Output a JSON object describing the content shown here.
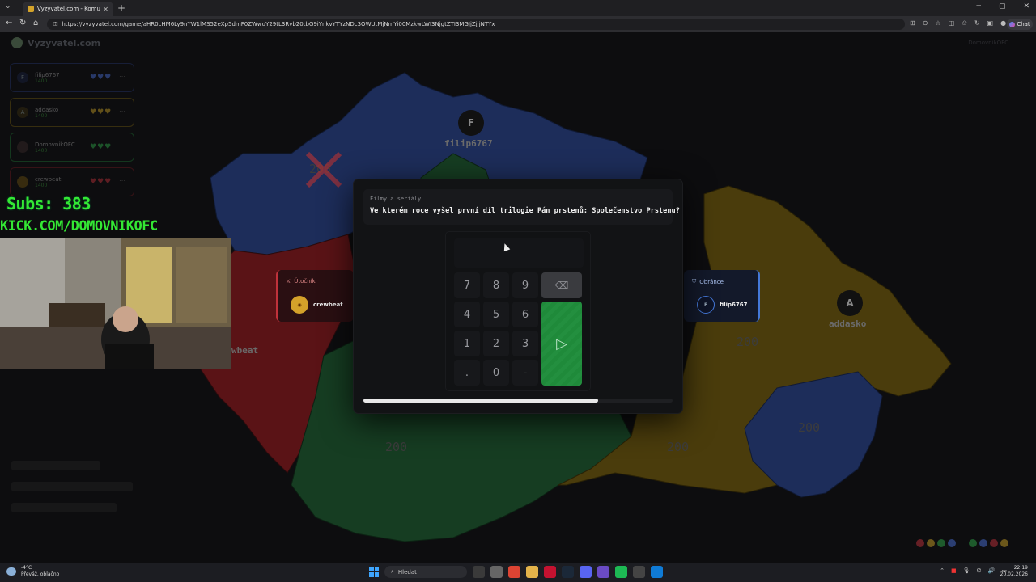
{
  "browser": {
    "tab_title": "Vyzyvatel.com - Komunitní vě",
    "url": "https://vyzyvatel.com/game/aHR0cHM6Ly9nYW1lMS52eXp5dmF0ZWwuY29tL3Rvb20tbG9iYnkvYTYzNDc3OWUtMjNmYi00MzkwLWI3NjgtZTI3MGJjZjJjNTYx",
    "chat_label": "Chat"
  },
  "site": {
    "logo_text": "Vyzyvatel.com",
    "current_user": "DomovnikOFC"
  },
  "players": [
    {
      "initial": "F",
      "name": "filip6767",
      "points": "1400",
      "color": "#4a6fd6"
    },
    {
      "initial": "A",
      "name": "addasko",
      "points": "1400",
      "color": "#c9a227"
    },
    {
      "initial": "",
      "name": "DomovnikOFC",
      "points": "1400",
      "color": "#2fa84a"
    },
    {
      "initial": "",
      "name": "crewbeat",
      "points": "1400",
      "color": "#c0323b"
    }
  ],
  "stream_overlay": {
    "subs": "Subs: 383",
    "kick": "KICK.COM/DOMOVNIKOFC"
  },
  "map": {
    "badges": [
      {
        "initial": "F",
        "name": "filip6767"
      },
      {
        "initial": "A",
        "name": "addasko"
      }
    ],
    "crewbeat_label": "wbeat",
    "region_values": [
      "200",
      "200",
      "200",
      "200",
      "200",
      "200"
    ]
  },
  "attacker": {
    "role_label": "Útočník",
    "player_name": "crewbeat"
  },
  "defender": {
    "role_label": "Obránce",
    "player_initial": "F",
    "player_name": "filip6767"
  },
  "question": {
    "category": "Filmy a seriály",
    "text": "Ve kterém roce vyšel první díl trilogie Pán prstenů: Společenstvo Prstenu?",
    "input_value": "",
    "time_remaining": 0.76
  },
  "keypad": {
    "keys": [
      "7",
      "8",
      "9",
      "4",
      "5",
      "6",
      "1",
      "2",
      "3",
      ".",
      "0",
      "-"
    ],
    "backspace_icon": "backspace-icon",
    "submit_icon": "play-icon"
  },
  "taskbar": {
    "temperature": "-4°C",
    "weather_text": "Převáž. oblačno",
    "search_placeholder": "Hledat",
    "time": "22:19",
    "date": "20.02.2026"
  }
}
